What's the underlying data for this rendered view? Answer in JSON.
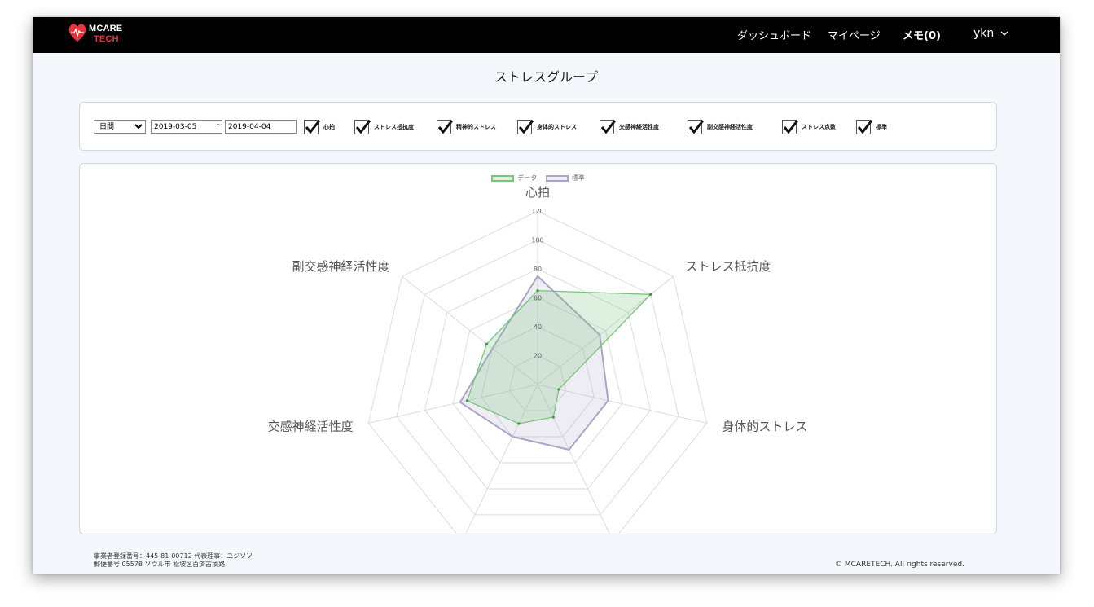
{
  "brand": {
    "name_line1": "MCARE",
    "name_line2": "TECH",
    "logo_colors": {
      "accent": "#e5343d",
      "text": "#ffffff"
    }
  },
  "nav": {
    "dashboard": "ダッシュボード",
    "mypage": "マイページ",
    "memo": "メモ(0)",
    "user": "ykn"
  },
  "page_title": "ストレスグループ",
  "filter": {
    "period_selected": "日間",
    "date_from": "2019-03-05",
    "separator": "~",
    "date_to": "2019-04-04",
    "checkboxes": [
      {
        "label": "心拍",
        "checked": true
      },
      {
        "label": "ストレス抵抗度",
        "checked": true
      },
      {
        "label": "精神的ストレス",
        "checked": true
      },
      {
        "label": "身体的ストレス",
        "checked": true
      },
      {
        "label": "交感神経活性度",
        "checked": true
      },
      {
        "label": "副交感神経活性度",
        "checked": true
      },
      {
        "label": "ストレス点数",
        "checked": true
      },
      {
        "label": "標準",
        "checked": true
      }
    ]
  },
  "chart_data": {
    "type": "radar",
    "axes": [
      "心拍",
      "ストレス抵抗度",
      "身体的ストレス",
      "精神的ストレス",
      "ストレス点数",
      "交感神経活性度",
      "副交感神経活性度"
    ],
    "range": [
      0,
      120
    ],
    "ticks": [
      20,
      40,
      60,
      80,
      100,
      120
    ],
    "series": [
      {
        "name": "データ",
        "values": [
          65,
          100,
          15,
          25,
          30,
          50,
          45
        ],
        "stroke": "#7cc37e",
        "fill": "rgba(124,195,126,0.25)"
      },
      {
        "name": "標準",
        "values": [
          75,
          55,
          50,
          50,
          40,
          55,
          40
        ],
        "stroke": "#a9a6c7",
        "fill": "rgba(169,166,199,0.2)"
      }
    ]
  },
  "footer": {
    "line1": "事業者登録番号：445-81-00712 代表理事：ユジソソ",
    "line2": "郵便番号 05578 ソウル市 松坡区百済古墳路",
    "copyright": "© MCARETECH. All rights reserved."
  }
}
